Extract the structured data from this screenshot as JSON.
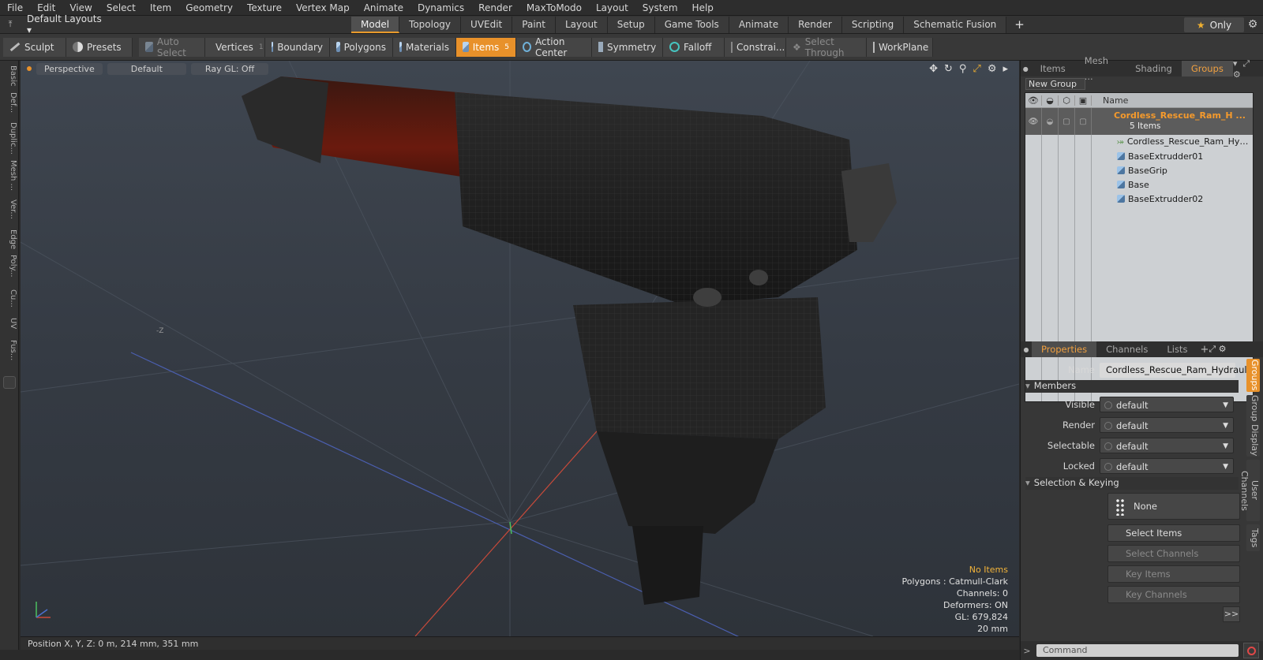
{
  "menu": [
    "File",
    "Edit",
    "View",
    "Select",
    "Item",
    "Geometry",
    "Texture",
    "Vertex Map",
    "Animate",
    "Dynamics",
    "Render",
    "MaxToModo",
    "Layout",
    "System",
    "Help"
  ],
  "layout_selector": "Default Layouts",
  "tabs": [
    "Model",
    "Topology",
    "UVEdit",
    "Paint",
    "Layout",
    "Setup",
    "Game Tools",
    "Animate",
    "Render",
    "Scripting",
    "Schematic Fusion"
  ],
  "active_tab": "Model",
  "only_label": "Only",
  "toolbar": {
    "sculpt": "Sculpt",
    "presets": "Presets",
    "auto_select": "Auto Select",
    "vertices": "Vertices",
    "vertices_count": "1",
    "boundary": "Boundary",
    "polygons": "Polygons",
    "materials": "Materials",
    "items": "Items",
    "items_count": "5",
    "action_center": "Action Center",
    "symmetry": "Symmetry",
    "falloff": "Falloff",
    "constraints": "Constrai...",
    "select_through": "Select Through",
    "workplane": "WorkPlane"
  },
  "left_strip": [
    "Basic",
    "Def...",
    "Duplic...",
    "Mesh ...",
    "Ver...",
    "Edge",
    "Poly...",
    "Cu...",
    "UV",
    "Fus..."
  ],
  "viewport": {
    "view": "Perspective",
    "shading": "Default",
    "raygl": "Ray GL: Off",
    "info": {
      "selection": "No Items",
      "polygons": "Polygons : Catmull-Clark",
      "channels": "Channels: 0",
      "deformers": "Deformers: ON",
      "gl": "GL: 679,824",
      "scale": "20 mm"
    },
    "axis_label": "-Z"
  },
  "status": "Position X, Y, Z:  0 m, 214 mm, 351 mm",
  "right_panel": {
    "tabs": [
      "Items",
      "Mesh ...",
      "Shading",
      "Groups"
    ],
    "active_tab": "Groups",
    "new_group": "New Group",
    "name_header": "Name",
    "group": {
      "name": "Cordless_Rescue_Ram_H ...",
      "count": "5 Items"
    },
    "items": [
      {
        "name": "Cordless_Rescue_Ram_Hyd...",
        "kind": "locator"
      },
      {
        "name": "BaseExtrudder01",
        "kind": "mesh"
      },
      {
        "name": "BaseGrip",
        "kind": "mesh"
      },
      {
        "name": "Base",
        "kind": "mesh"
      },
      {
        "name": "BaseExtrudder02",
        "kind": "mesh"
      }
    ]
  },
  "properties": {
    "tabs": [
      "Properties",
      "Channels",
      "Lists"
    ],
    "active_tab": "Properties",
    "name_label": "Name",
    "name_value": "Cordless_Rescue_Ram_Hydraulic",
    "members_section": "Members",
    "visible_label": "Visible",
    "visible_value": "default",
    "render_label": "Render",
    "render_value": "default",
    "selectable_label": "Selectable",
    "selectable_value": "default",
    "locked_label": "Locked",
    "locked_value": "default",
    "selkey_section": "Selection & Keying",
    "none_btn": "None",
    "select_items": "Select Items",
    "select_channels": "Select Channels",
    "key_items": "Key Items",
    "key_channels": "Key Channels",
    "more": ">>",
    "side_tabs": [
      "Groups",
      "Group Display",
      "User Channels",
      "Tags"
    ]
  },
  "command_placeholder": "Command",
  "colors": {
    "accent": "#e8912a",
    "group_text": "#f59a2c",
    "warning": "#f3b43a"
  }
}
